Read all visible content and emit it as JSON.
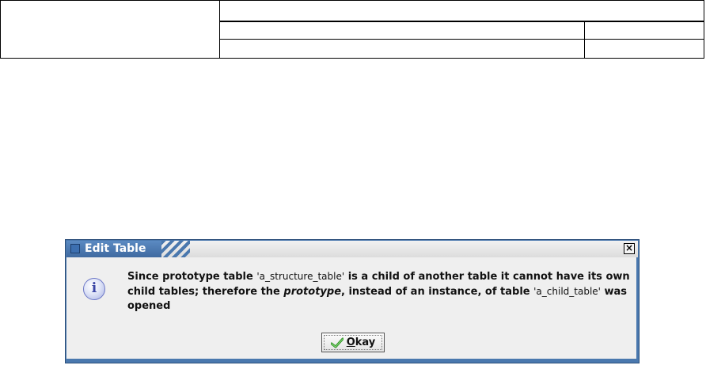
{
  "dialog": {
    "title": "Edit Table",
    "close_glyph": "×",
    "message_part1": "Since prototype table ",
    "message_table1": "'a_structure_table'",
    "message_part2": " is a child of another table it cannot have its own child tables; therefore the ",
    "message_italic": "prototype",
    "message_part3": ", instead of an instance, of table ",
    "message_table2": "'a_child_table'",
    "message_part4": " was opened",
    "icon": "info-icon",
    "okay_mnemonic": "O",
    "okay_rest": "kay"
  },
  "colors": {
    "title_bar": "#4a78ae",
    "dialog_body": "#efefef",
    "check_green": "#3aa52f"
  }
}
